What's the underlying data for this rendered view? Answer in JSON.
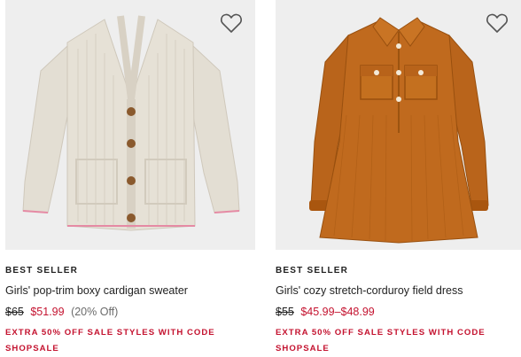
{
  "products": [
    {
      "badge": "BEST SELLER",
      "title": "Girls' pop-trim boxy cardigan sweater",
      "price_original": "$65",
      "price_sale": "$51.99",
      "discount": "(20% Off)",
      "promo": "EXTRA 50% OFF SALE STYLES WITH CODE SHOPSALE",
      "image": "cream-cardigan-sweater",
      "wishlist_icon": "heart-outline-icon"
    },
    {
      "badge": "BEST SELLER",
      "title": "Girls' cozy stretch-corduroy field dress",
      "price_original": "$55",
      "price_sale": "$45.99–$48.99",
      "discount": "",
      "promo": "EXTRA 50% OFF SALE STYLES WITH CODE SHOPSALE",
      "image": "rust-corduroy-dress",
      "wishlist_icon": "heart-outline-icon"
    }
  ],
  "colors": {
    "sale_red": "#c4122f",
    "image_bg": "#eeeeee",
    "text": "#1f1f1f",
    "muted": "#6b6b6b"
  }
}
